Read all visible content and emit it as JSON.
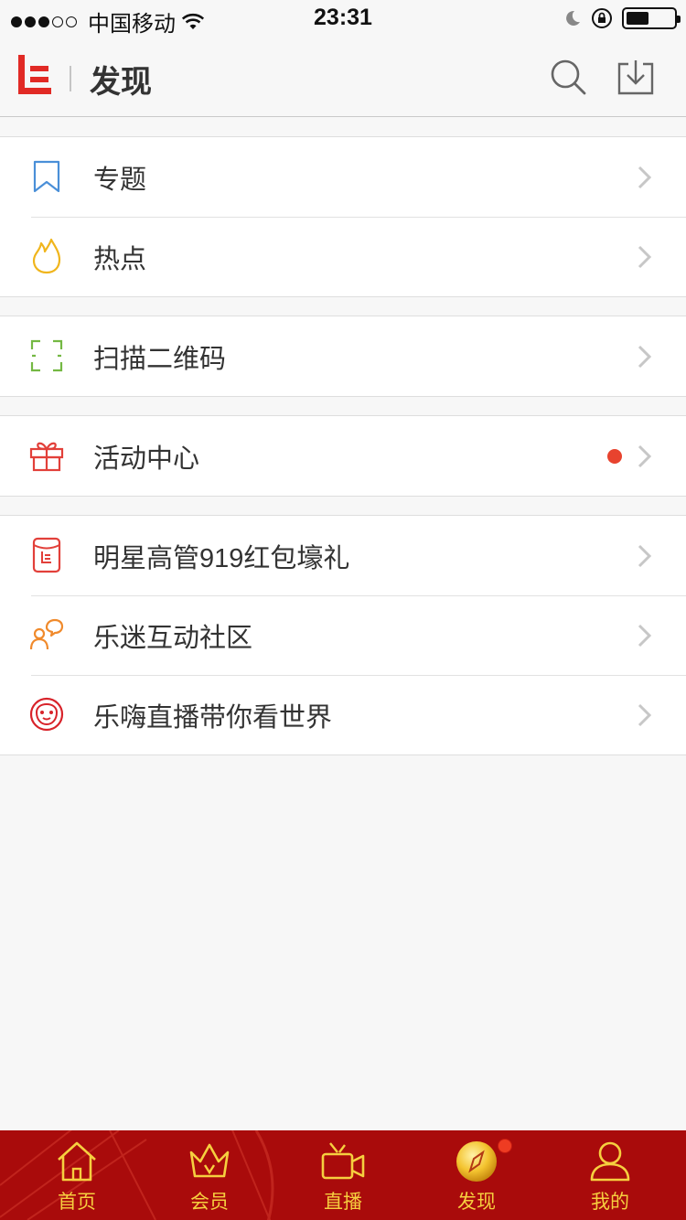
{
  "status_bar": {
    "carrier": "中国移动",
    "time": "23:31"
  },
  "nav": {
    "title": "发现",
    "logo_icon": "letv-logo",
    "search_icon": "search-icon",
    "download_icon": "download-icon"
  },
  "groups": [
    {
      "items": [
        {
          "label": "专题",
          "icon": "bookmark-icon",
          "color": "#4a8fd8"
        },
        {
          "label": "热点",
          "icon": "flame-icon",
          "color": "#f0b51c"
        }
      ]
    },
    {
      "items": [
        {
          "label": "扫描二维码",
          "icon": "scan-icon",
          "color": "#74b843"
        }
      ]
    },
    {
      "items": [
        {
          "label": "活动中心",
          "icon": "gift-icon",
          "color": "#e2403a",
          "badge": true
        }
      ]
    },
    {
      "items": [
        {
          "label": "明星高管919红包壕礼",
          "icon": "red-packet-icon",
          "color": "#e2403a"
        },
        {
          "label": "乐迷互动社区",
          "icon": "community-icon",
          "color": "#f08a2c"
        },
        {
          "label": "乐嗨直播带你看世界",
          "icon": "live-face-icon",
          "color": "#d8232a"
        }
      ]
    }
  ],
  "tabbar": {
    "active_color": "#f6cf3f",
    "background": "#a90b0b",
    "tabs": [
      {
        "label": "首页",
        "icon": "home-icon"
      },
      {
        "label": "会员",
        "icon": "crown-icon"
      },
      {
        "label": "直播",
        "icon": "video-camera-icon"
      },
      {
        "label": "发现",
        "icon": "compass-icon",
        "active": true,
        "badge": true
      },
      {
        "label": "我的",
        "icon": "user-icon"
      }
    ]
  }
}
